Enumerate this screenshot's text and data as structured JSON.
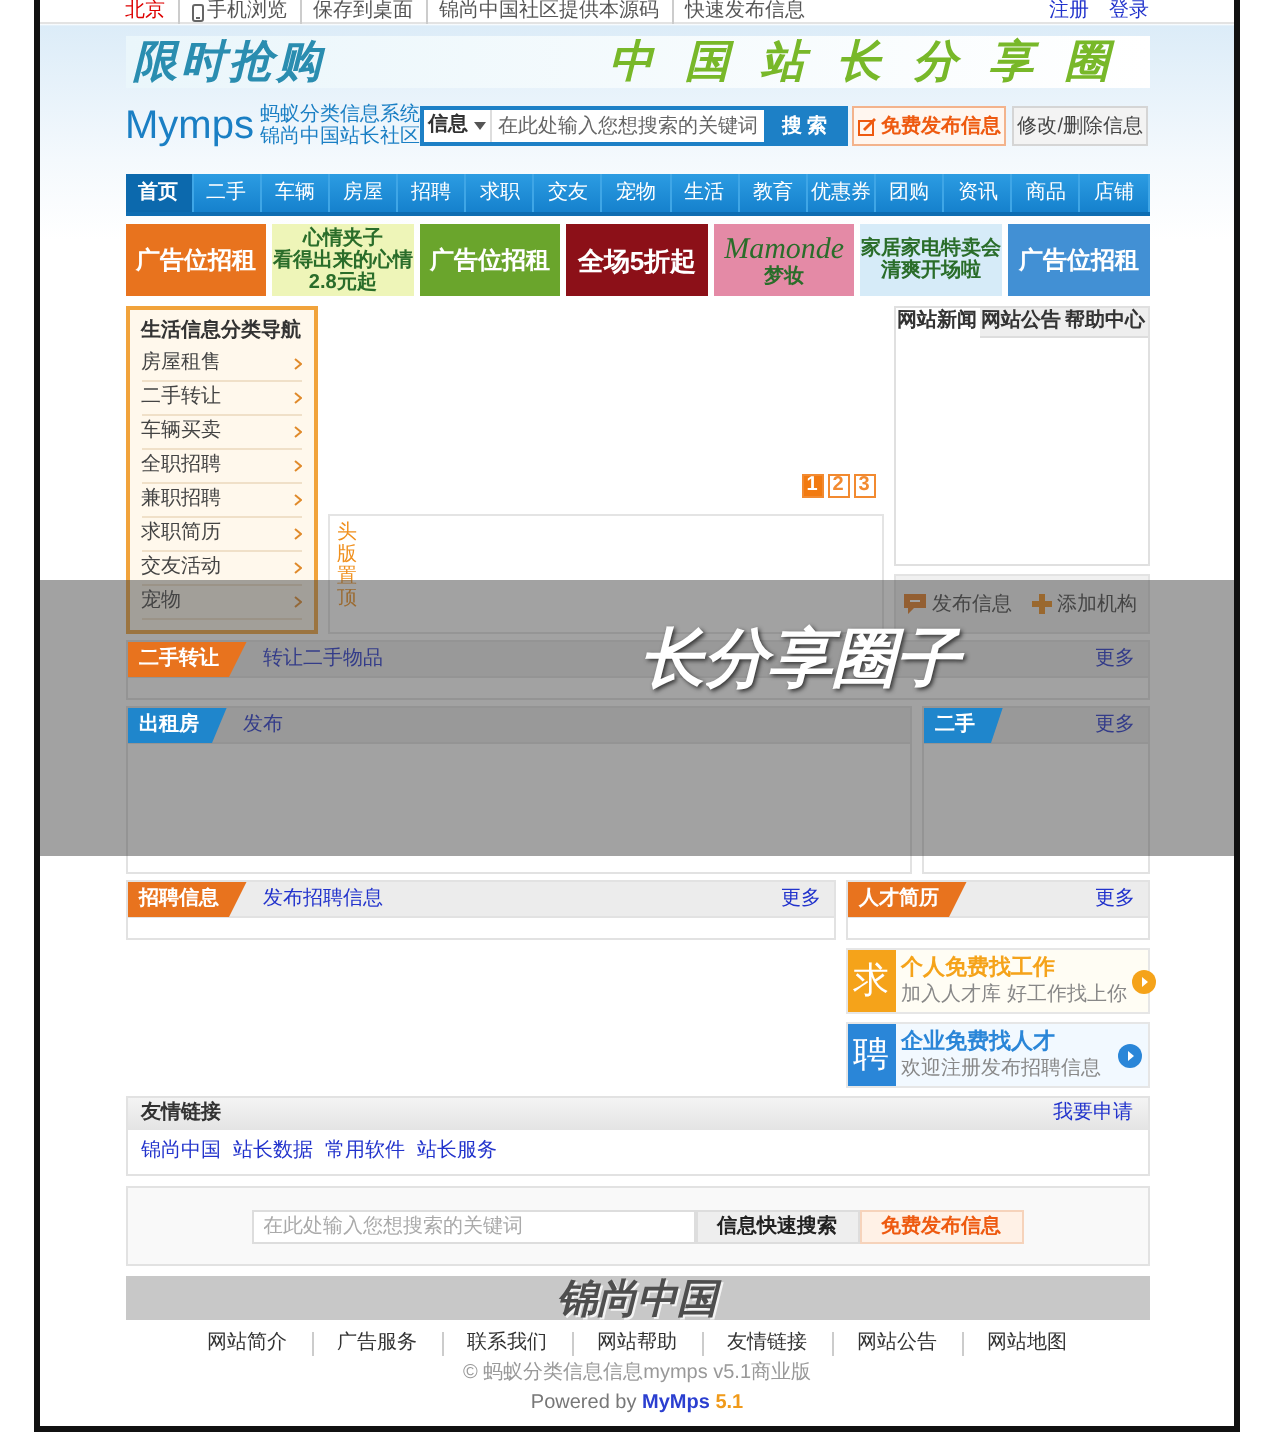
{
  "top_bar": {
    "city": "北京",
    "links": [
      "手机浏览",
      "保存到桌面",
      "锦尚中国社区提供本源码",
      "快速发布信息"
    ],
    "user_links": [
      "注册",
      "登录"
    ]
  },
  "banner": {
    "title": "限时抢购",
    "subtitle": "中国站长分享圈"
  },
  "logo": {
    "name": "Mymps",
    "tagline": [
      "蚂蚁分类信息系统",
      "锦尚中国站长社区"
    ]
  },
  "search": {
    "category": "信息",
    "placeholder": "在此处输入您想搜索的关键词",
    "button": "搜 索"
  },
  "header_buttons": [
    {
      "kind": "primary",
      "label": "免费发布信息"
    },
    {
      "kind": "secondary",
      "label": "修改/删除信息"
    }
  ],
  "nav": [
    {
      "label": "首页",
      "selected": true
    },
    {
      "label": "二手",
      "selected": false
    },
    {
      "label": "车辆",
      "selected": false
    },
    {
      "label": "房屋",
      "selected": false
    },
    {
      "label": "招聘",
      "selected": false
    },
    {
      "label": "求职",
      "selected": false
    },
    {
      "label": "交友",
      "selected": false
    },
    {
      "label": "宠物",
      "selected": false
    },
    {
      "label": "生活",
      "selected": false
    },
    {
      "label": "教育",
      "selected": false
    },
    {
      "label": "优惠券",
      "selected": false
    },
    {
      "label": "团购",
      "selected": false
    },
    {
      "label": "资讯",
      "selected": false
    },
    {
      "label": "商品",
      "selected": false
    },
    {
      "label": "店铺",
      "selected": false
    }
  ],
  "ads": [
    {
      "kind": "rent",
      "lines": [
        "广告位招租"
      ],
      "color": "#e8731e"
    },
    {
      "kind": "promo",
      "lines": [
        "心情夹子",
        "看得出来的心情",
        "2.8元起"
      ],
      "color": "#eef5b8"
    },
    {
      "kind": "rent",
      "lines": [
        "广告位招租"
      ],
      "color": "#6aa52c"
    },
    {
      "kind": "promo",
      "lines": [
        "全场5折起"
      ],
      "color": "#8c1018"
    },
    {
      "kind": "brand",
      "lines": [
        "Mamonde",
        "梦妆"
      ],
      "color": "#e48aa6"
    },
    {
      "kind": "promo",
      "lines": [
        "家居家电特卖会",
        "清爽开场啦"
      ],
      "color": "#d6ebf8"
    },
    {
      "kind": "rent",
      "lines": [
        "广告位招租"
      ],
      "color": "#4290d4"
    }
  ],
  "sidebar": {
    "title": "生活信息分类导航",
    "items": [
      "房屋租售",
      "二手转让",
      "车辆买卖",
      "全职招聘",
      "兼职招聘",
      "求职简历",
      "交友活动",
      "宠物"
    ]
  },
  "slider": {
    "pages": [
      {
        "label": "1",
        "selected": true
      },
      {
        "label": "2",
        "selected": false
      },
      {
        "label": "3",
        "selected": false
      }
    ]
  },
  "headline": {
    "label": "头版置顶"
  },
  "news_tabs": [
    {
      "label": "网站新闻",
      "selected": true
    },
    {
      "label": "网站公告",
      "selected": false
    },
    {
      "label": "帮助中心",
      "selected": false
    }
  ],
  "actions": [
    {
      "kind": "post",
      "label": "发布信息"
    },
    {
      "kind": "add",
      "label": "添加机构"
    }
  ],
  "overlay": {
    "title": "长分享圈子"
  },
  "second_hand": {
    "label": "二手转让",
    "color": "#e8731e",
    "link": "转让二手物品",
    "more": "更多"
  },
  "rentals": {
    "label": "出租房",
    "color": "#1f86cc",
    "link": "发布"
  },
  "rentals_side": {
    "label": "二手",
    "color": "#1f86cc",
    "more": "更多"
  },
  "jobs": {
    "label": "招聘信息",
    "color": "#e8731e",
    "link": "发布招聘信息",
    "more": "更多"
  },
  "resumes": {
    "label": "人才简历",
    "color": "#e8731e",
    "more": "更多"
  },
  "promo_cards": [
    {
      "char": "求",
      "title": "个人免费找工作",
      "subtitle": "加入人才库 好工作找上你",
      "color": "#f5a31a"
    },
    {
      "char": "聘",
      "title": "企业免费找人才",
      "subtitle": "欢迎注册发布招聘信息",
      "color": "#2a86d8"
    }
  ],
  "friend_links": {
    "title": "友情链接",
    "apply": "我要申请",
    "links": [
      "锦尚中国",
      "站长数据",
      "常用软件",
      "站长服务"
    ]
  },
  "bottom_search": {
    "placeholder": "在此处输入您想搜索的关键词",
    "search_button": "信息快速搜索",
    "post_button": "免费发布信息"
  },
  "footer_banner": "锦尚中国",
  "footer_links": [
    "网站简介",
    "广告服务",
    "联系我们",
    "网站帮助",
    "友情链接",
    "网站公告",
    "网站地图"
  ],
  "copyright": "© 蚂蚁分类信息信息mymps v5.1商业版",
  "powered": {
    "prefix": "Powered by",
    "brand": "MyMps",
    "version": "5.1"
  }
}
